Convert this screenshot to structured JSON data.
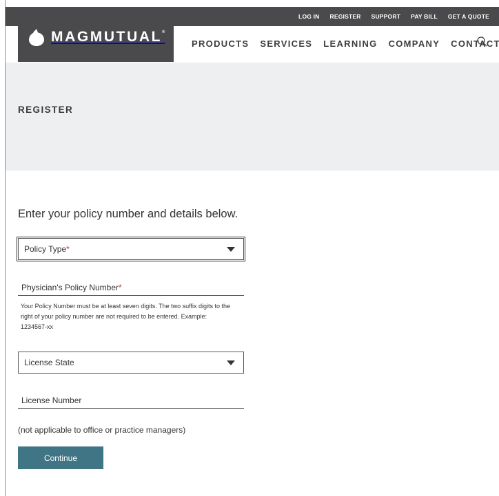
{
  "utility_nav": [
    "LOG IN",
    "REGISTER",
    "SUPPORT",
    "PAY BILL",
    "GET A QUOTE"
  ],
  "brand": {
    "name": "MAGMUTUAL",
    "mark": "®"
  },
  "main_nav": [
    "PRODUCTS",
    "SERVICES",
    "LEARNING",
    "COMPANY",
    "CONTACT"
  ],
  "search": {
    "icon": "search-icon"
  },
  "hero": {
    "title": "REGISTER"
  },
  "form": {
    "intro": "Enter your policy number and details below.",
    "policy_type": {
      "label": "Policy Type",
      "required": "*"
    },
    "policy_number": {
      "label": "Physician's Policy Number",
      "required": "*"
    },
    "help_text": "Your Policy Number must be at least seven digits. The two suffix digits to the right of your policy number are not required to be entered. Example: 1234567-xx",
    "license_state": {
      "label": "License State"
    },
    "license_number": {
      "label": "License Number"
    },
    "note": "(not applicable to office or practice managers)",
    "submit_label": "Continue"
  },
  "colors": {
    "header_bg": "#4a4a4c",
    "hero_bg": "#eeeff1",
    "button_bg": "#3f7585",
    "required": "#c0392b"
  }
}
